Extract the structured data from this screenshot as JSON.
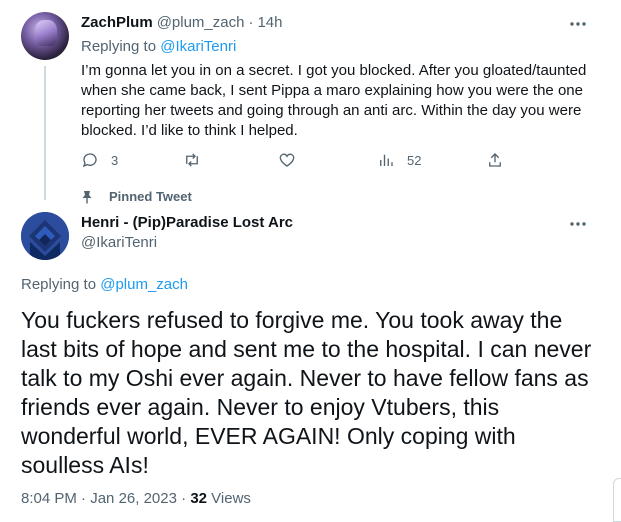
{
  "reply": {
    "name": "ZachPlum",
    "handle": "@plum_zach",
    "separator": "·",
    "time": "14h",
    "replying_prefix": "Replying to ",
    "replying_to": "@IkariTenri",
    "text": "I’m gonna let you in on a secret. I got you blocked. After you gloated/taunted when she came back, I sent Pippa a maro explaining how you were the one reporting her tweets and going through an anti arc. Within the day you were blocked. I’d like to think I helped.",
    "replies_count": "3",
    "views_count": "52",
    "icons": [
      "comment-icon",
      "retweet-icon",
      "heart-icon",
      "analytics-icon",
      "share-icon"
    ]
  },
  "pinned_label": "Pinned Tweet",
  "main": {
    "name": "Henri - (Pip)Paradise Lost Arc",
    "handle": "@IkariTenri",
    "replying_prefix": "Replying to ",
    "replying_to": "@plum_zach",
    "text": "You fuckers refused to forgive me. You took away the last bits of hope and sent me to the hospital. I can never talk to my Oshi ever again. Never to have fellow fans as friends ever again. Never to enjoy Vtubers, this wonderful world, EVER AGAIN! Only coping with soulless AIs!",
    "time": "8:04 PM",
    "separator": " · ",
    "date": "Jan 26, 2023",
    "views_count": "32",
    "views_label": " Views"
  },
  "colors": {
    "link": "#1d9bf0",
    "secondary_text": "#536471",
    "primary_text": "#0f1419",
    "thread_line": "#cfd9de"
  }
}
